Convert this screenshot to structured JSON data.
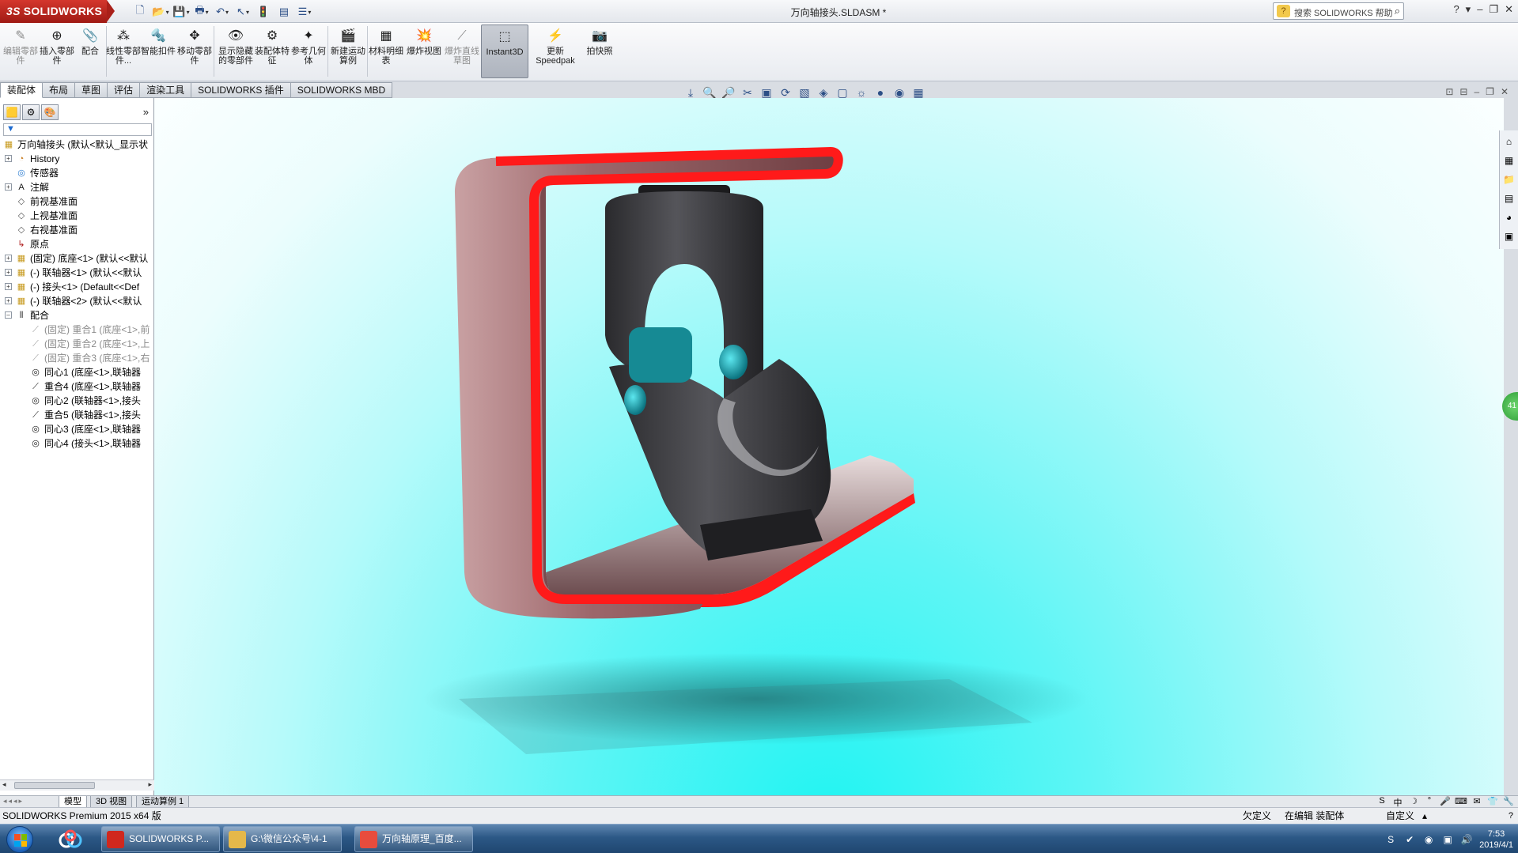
{
  "app": {
    "logo_prefix": "3S",
    "logo_text": "SOLIDWORKS",
    "doc_title": "万向轴接头.SLDASM *",
    "search_placeholder": "搜索 SOLIDWORKS 帮助",
    "search_icon_glyph": "?",
    "quick_access": [
      {
        "name": "new-icon",
        "glyph": "🗋"
      },
      {
        "name": "open-icon",
        "glyph": "📂"
      },
      {
        "name": "save-icon",
        "glyph": "💾"
      },
      {
        "name": "print-icon",
        "glyph": "🖶"
      },
      {
        "name": "undo-icon",
        "glyph": "↶"
      },
      {
        "name": "select-icon",
        "glyph": "↖"
      },
      {
        "name": "rebuild-icon",
        "glyph": "🚦"
      },
      {
        "name": "file-properties-icon",
        "glyph": "▤"
      },
      {
        "name": "options-icon",
        "glyph": "☰"
      }
    ],
    "window_controls": [
      "?",
      "▾",
      "–",
      "❐",
      "✕"
    ]
  },
  "ribbon": {
    "buttons": [
      {
        "id": "edit-component",
        "label": "编辑零部件",
        "glyph": "✎",
        "disabled": true
      },
      {
        "id": "insert-components",
        "label": "插入零部件",
        "glyph": "⊕",
        "disabled": false
      },
      {
        "id": "mate",
        "label": "配合",
        "glyph": "📎",
        "disabled": false
      },
      {
        "id": "linear-pattern",
        "label": "线性零部件...",
        "glyph": "⁂",
        "disabled": false
      },
      {
        "id": "smart-fasteners",
        "label": "智能扣件",
        "glyph": "🔩",
        "disabled": false
      },
      {
        "id": "move-component",
        "label": "移动零部件",
        "glyph": "✥",
        "disabled": false
      },
      {
        "id": "show-hidden",
        "label": "显示隐藏的零部件",
        "glyph": "👁",
        "disabled": false
      },
      {
        "id": "assembly-features",
        "label": "装配体特征",
        "glyph": "⚙",
        "disabled": false
      },
      {
        "id": "reference-geometry",
        "label": "参考几何体",
        "glyph": "✦",
        "disabled": false
      },
      {
        "id": "new-motion-study",
        "label": "新建运动算例",
        "glyph": "🎬",
        "disabled": false
      },
      {
        "id": "bom",
        "label": "材料明细表",
        "glyph": "▦",
        "disabled": false
      },
      {
        "id": "exploded-view",
        "label": "爆炸视图",
        "glyph": "💥",
        "disabled": false
      },
      {
        "id": "explode-line",
        "label": "爆炸直线草图",
        "glyph": "⟋",
        "disabled": true
      },
      {
        "id": "instant3d",
        "label": "Instant3D",
        "glyph": "⬚",
        "disabled": false,
        "active": true
      },
      {
        "id": "update-speedpak",
        "label": "更新Speedpak",
        "glyph": "⚡",
        "disabled": false
      },
      {
        "id": "snapshot",
        "label": "拍快照",
        "glyph": "📷",
        "disabled": false
      }
    ]
  },
  "command_tabs": [
    "装配体",
    "布局",
    "草图",
    "评估",
    "渲染工具",
    "SOLIDWORKS 插件",
    "SOLIDWORKS MBD"
  ],
  "view_tools": [
    "⤓",
    "🔍",
    "🔎",
    "✂",
    "▣",
    "⟳",
    "▧",
    "◈",
    "▢",
    "☼",
    "●",
    "◉",
    "▦"
  ],
  "viewport_controls": [
    "⊡",
    "⊟",
    "–",
    "❐",
    "✕"
  ],
  "feature_manager": {
    "tab_icons": [
      "🟨",
      "⚙",
      "🎨"
    ],
    "expand_glyph": "»",
    "filter_glyph": "▼",
    "tree": [
      {
        "label": "万向轴接头  (默认<默认_显示状",
        "level": 0,
        "expander": "",
        "icon": "▦",
        "icon_color": "#c79a1e",
        "dim": false
      },
      {
        "label": "History",
        "level": 1,
        "expander": "+",
        "icon": "◔",
        "icon_color": "#c77a1e",
        "dim": false
      },
      {
        "label": "传感器",
        "level": 1,
        "expander": "",
        "icon": "◎",
        "icon_color": "#2a7cd1",
        "dim": false
      },
      {
        "label": "注解",
        "level": 1,
        "expander": "+",
        "icon": "A",
        "icon_color": "#1c1c1c",
        "dim": false
      },
      {
        "label": "前视基准面",
        "level": 1,
        "expander": "",
        "icon": "◇",
        "icon_color": "#555",
        "dim": false
      },
      {
        "label": "上视基准面",
        "level": 1,
        "expander": "",
        "icon": "◇",
        "icon_color": "#555",
        "dim": false
      },
      {
        "label": "右视基准面",
        "level": 1,
        "expander": "",
        "icon": "◇",
        "icon_color": "#555",
        "dim": false
      },
      {
        "label": "原点",
        "level": 1,
        "expander": "",
        "icon": "↳",
        "icon_color": "#b02020",
        "dim": false
      },
      {
        "label": "(固定) 底座<1> (默认<<默认",
        "level": 1,
        "expander": "+",
        "icon": "▦",
        "icon_color": "#c79a1e",
        "dim": false
      },
      {
        "label": "(-) 联轴器<1> (默认<<默认",
        "level": 1,
        "expander": "+",
        "icon": "▦",
        "icon_color": "#c79a1e",
        "dim": false
      },
      {
        "label": "(-) 接头<1> (Default<<Def",
        "level": 1,
        "expander": "+",
        "icon": "▦",
        "icon_color": "#c79a1e",
        "dim": false
      },
      {
        "label": "(-) 联轴器<2> (默认<<默认",
        "level": 1,
        "expander": "+",
        "icon": "▦",
        "icon_color": "#c79a1e",
        "dim": false
      },
      {
        "label": "配合",
        "level": 1,
        "expander": "–",
        "icon": "⫴",
        "icon_color": "#333",
        "dim": false
      },
      {
        "label": "(固定) 重合1 (底座<1>,前",
        "level": 2,
        "expander": "",
        "icon": "⟋",
        "icon_color": "#9a9a9a",
        "dim": true
      },
      {
        "label": "(固定) 重合2 (底座<1>,上",
        "level": 2,
        "expander": "",
        "icon": "⟋",
        "icon_color": "#9a9a9a",
        "dim": true
      },
      {
        "label": "(固定) 重合3 (底座<1>,右",
        "level": 2,
        "expander": "",
        "icon": "⟋",
        "icon_color": "#9a9a9a",
        "dim": true
      },
      {
        "label": "同心1 (底座<1>,联轴器",
        "level": 2,
        "expander": "",
        "icon": "◎",
        "icon_color": "#222",
        "dim": false
      },
      {
        "label": "重合4 (底座<1>,联轴器",
        "level": 2,
        "expander": "",
        "icon": "⟋",
        "icon_color": "#222",
        "dim": false
      },
      {
        "label": "同心2 (联轴器<1>,接头",
        "level": 2,
        "expander": "",
        "icon": "◎",
        "icon_color": "#222",
        "dim": false
      },
      {
        "label": "重合5 (联轴器<1>,接头",
        "level": 2,
        "expander": "",
        "icon": "⟋",
        "icon_color": "#222",
        "dim": false
      },
      {
        "label": "同心3 (底座<1>,联轴器",
        "level": 2,
        "expander": "",
        "icon": "◎",
        "icon_color": "#222",
        "dim": false
      },
      {
        "label": "同心4 (接头<1>,联轴器",
        "level": 2,
        "expander": "",
        "icon": "◎",
        "icon_color": "#222",
        "dim": false
      }
    ]
  },
  "right_taskpane_icons": [
    "⌂",
    "▦",
    "📁",
    "▤",
    "◕",
    "▣"
  ],
  "green_button_text": "41",
  "bottom_tabs": {
    "nav": "◂◂◂▸",
    "tabs": [
      "模型",
      "3D 视图",
      "运动算例 1"
    ],
    "active": "模型",
    "tray_icons": [
      "S",
      "中",
      "☽",
      "°",
      "🎤",
      "⌨",
      "✉",
      "👕",
      "🔧"
    ]
  },
  "status": {
    "product": "SOLIDWORKS Premium 2015 x64 版",
    "underdefined": "欠定义",
    "editing": "在编辑 装配体",
    "units": "自定义",
    "units_arrow": "▴",
    "help_glyph": "?"
  },
  "taskbar": {
    "apps": [
      {
        "name": "solidworks",
        "label": "SOLIDWORKS P...",
        "icon_color": "#d0281e"
      },
      {
        "name": "explorer",
        "label": "G:\\微信公众号\\4-1",
        "icon_color": "#e5b84a"
      },
      {
        "name": "browser",
        "label": "万向轴原理_百度...",
        "icon_color": "#e84c3d"
      }
    ],
    "time": "7:53",
    "date": "2019/4/1",
    "tray_icons": [
      "S",
      "✔",
      "◉",
      "▣",
      "🔊"
    ]
  },
  "colors": {
    "frame_edge": "#ff1a1a",
    "frame_body": "#9a6064",
    "yoke": "#3b3b3e",
    "pin": "#17a9b4",
    "viewport_center": "#1ff4f2"
  }
}
